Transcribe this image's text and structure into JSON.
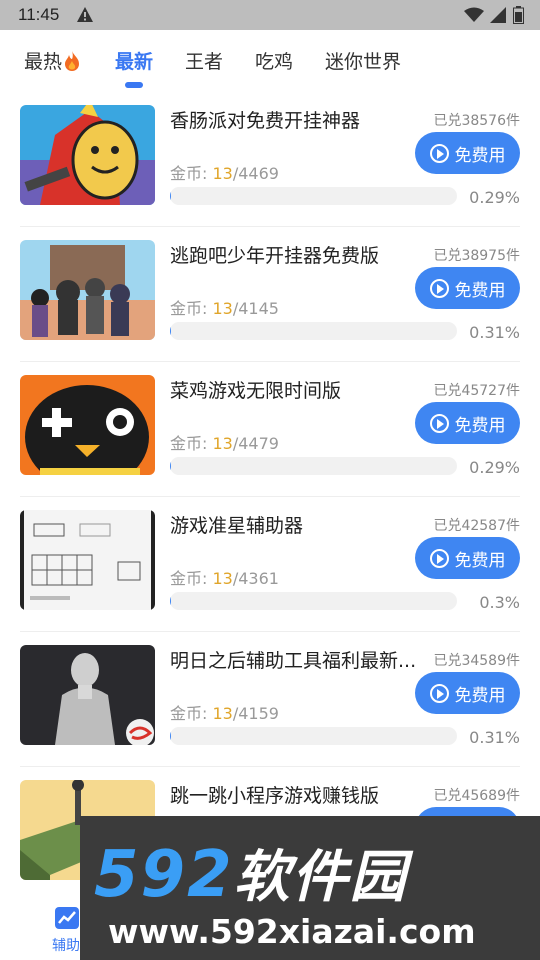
{
  "status_bar": {
    "time": "11:45",
    "icons": [
      "alert-icon",
      "wifi-icon",
      "signal-icon",
      "battery-icon"
    ]
  },
  "tabs": [
    {
      "label": "最热",
      "icon": "fire-icon",
      "active": false
    },
    {
      "label": "最新",
      "active": true
    },
    {
      "label": "王者",
      "active": false
    },
    {
      "label": "吃鸡",
      "active": false
    },
    {
      "label": "迷你世界",
      "active": false
    }
  ],
  "items": [
    {
      "title": "香肠派对免费开挂神器",
      "redeemed": "已兑38576件",
      "coins_label": "金币: ",
      "coins_current": "13",
      "coins_total": "/4469",
      "button": "免费用",
      "progress": 0.29,
      "percent": "0.29%",
      "thumb": "cartoon-characters"
    },
    {
      "title": "逃跑吧少年开挂器免费版",
      "redeemed": "已兑38975件",
      "coins_label": "金币: ",
      "coins_current": "13",
      "coins_total": "/4145",
      "button": "免费用",
      "progress": 0.31,
      "percent": "0.31%",
      "thumb": "game-characters"
    },
    {
      "title": "菜鸡游戏无限时间版",
      "redeemed": "已兑45727件",
      "coins_label": "金币: ",
      "coins_current": "13",
      "coins_total": "/4479",
      "button": "免费用",
      "progress": 0.29,
      "percent": "0.29%",
      "thumb": "penguin-gamepad"
    },
    {
      "title": "游戏准星辅助器",
      "redeemed": "已兑42587件",
      "coins_label": "金币: ",
      "coins_current": "13",
      "coins_total": "/4361",
      "button": "免费用",
      "progress": 0.3,
      "percent": "0.3%",
      "thumb": "settings-panel"
    },
    {
      "title": "明日之后辅助工具福利最新...",
      "redeemed": "已兑34589件",
      "coins_label": "金币: ",
      "coins_current": "13",
      "coins_total": "/4159",
      "button": "免费用",
      "progress": 0.31,
      "percent": "0.31%",
      "thumb": "dark-silhouette"
    },
    {
      "title": "跳一跳小程序游戏赚钱版",
      "redeemed": "已兑45689件",
      "thumb": "jump-game"
    }
  ],
  "bottom_nav": {
    "label": "辅助",
    "icon": "chart-icon"
  },
  "watermark": {
    "numbers": "592",
    "name": "软件园",
    "url": "www.592xiazai.com"
  },
  "colors": {
    "accent": "#3f86f2",
    "coin": "#e0a52a",
    "status_bar": "#bdbdbd"
  }
}
